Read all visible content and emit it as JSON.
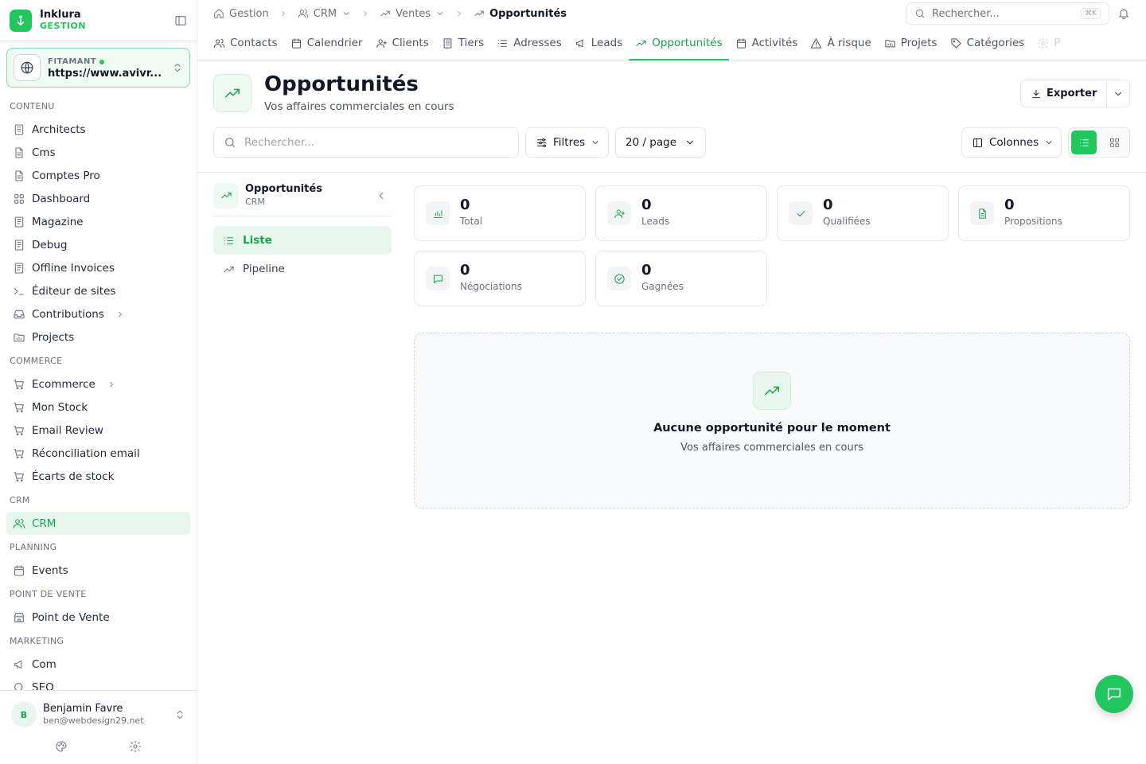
{
  "brand": {
    "name": "Inklura",
    "sub": "GESTION"
  },
  "site": {
    "tag": "FITAMANT",
    "url": "https://www.avivr..."
  },
  "nav": {
    "groups": [
      {
        "label": "CONTENU",
        "items": [
          {
            "label": "Architects",
            "icon": "building-icon"
          },
          {
            "label": "Cms",
            "icon": "file-icon"
          },
          {
            "label": "Comptes Pro",
            "icon": "file-icon"
          },
          {
            "label": "Dashboard",
            "icon": "grid-icon"
          },
          {
            "label": "Magazine",
            "icon": "book-icon"
          },
          {
            "label": "Debug",
            "icon": "book-icon"
          },
          {
            "label": "Offline Invoices",
            "icon": "book-icon"
          },
          {
            "label": "Éditeur de sites",
            "icon": "terminal-icon"
          },
          {
            "label": "Contributions",
            "icon": "inbox-icon",
            "has_children": true
          },
          {
            "label": "Projects",
            "icon": "folder-icon"
          }
        ]
      },
      {
        "label": "COMMERCE",
        "items": [
          {
            "label": "Ecommerce",
            "icon": "cart-icon",
            "has_children": true
          },
          {
            "label": "Mon Stock",
            "icon": "cart-icon"
          },
          {
            "label": "Email Review",
            "icon": "cart-icon"
          },
          {
            "label": "Réconciliation email",
            "icon": "cart-icon"
          },
          {
            "label": "Écarts de stock",
            "icon": "cart-icon"
          }
        ]
      },
      {
        "label": "CRM",
        "items": [
          {
            "label": "CRM",
            "icon": "users-icon",
            "active": true
          }
        ]
      },
      {
        "label": "PLANNING",
        "items": [
          {
            "label": "Events",
            "icon": "calendar-icon"
          }
        ]
      },
      {
        "label": "POINT DE VENTE",
        "items": [
          {
            "label": "Point de Vente",
            "icon": "store-icon"
          }
        ]
      },
      {
        "label": "MARKETING",
        "items": [
          {
            "label": "Com",
            "icon": "megaphone-icon"
          },
          {
            "label": "SEO",
            "icon": "search-icon"
          }
        ]
      }
    ]
  },
  "user": {
    "initial": "B",
    "name": "Benjamin Favre",
    "email": "ben@webdesign29.net"
  },
  "breadcrumb": {
    "home": "Gestion",
    "crm": "CRM",
    "ventes": "Ventes",
    "current": "Opportunités"
  },
  "topsearch": {
    "placeholder": "Rechercher...",
    "shortcut": "⌘K"
  },
  "tabs": [
    {
      "label": "Contacts",
      "icon": "users-icon"
    },
    {
      "label": "Calendrier",
      "icon": "calendar-icon"
    },
    {
      "label": "Clients",
      "icon": "user-plus-icon"
    },
    {
      "label": "Tiers",
      "icon": "building-icon"
    },
    {
      "label": "Adresses",
      "icon": "list-icon"
    },
    {
      "label": "Leads",
      "icon": "megaphone-icon"
    },
    {
      "label": "Opportunités",
      "icon": "trending-up-icon",
      "active": true
    },
    {
      "label": "Activités",
      "icon": "calendar-icon"
    },
    {
      "label": "À risque",
      "icon": "alert-icon"
    },
    {
      "label": "Projets",
      "icon": "folder-icon"
    },
    {
      "label": "Catégories",
      "icon": "tag-icon"
    },
    {
      "label": "P",
      "icon": "gear-icon"
    }
  ],
  "page": {
    "title": "Opportunités",
    "subtitle": "Vos affaires commerciales en cours",
    "export_label": "Exporter"
  },
  "toolbar": {
    "search_placeholder": "Rechercher...",
    "filters_label": "Filtres",
    "page_size": "20 / page",
    "columns_label": "Colonnes"
  },
  "subnav": {
    "title": "Opportunités",
    "subtitle": "CRM",
    "items": [
      {
        "label": "Liste",
        "active": true
      },
      {
        "label": "Pipeline"
      }
    ]
  },
  "stats": [
    {
      "value": "0",
      "label": "Total",
      "icon": "bar-chart-icon"
    },
    {
      "value": "0",
      "label": "Leads",
      "icon": "user-plus-icon"
    },
    {
      "value": "0",
      "label": "Qualifiées",
      "icon": "check-icon"
    },
    {
      "value": "0",
      "label": "Propositions",
      "icon": "file-text-icon"
    },
    {
      "value": "0",
      "label": "Négociations",
      "icon": "message-icon"
    },
    {
      "value": "0",
      "label": "Gagnées",
      "icon": "check-circle-icon"
    }
  ],
  "empty": {
    "title": "Aucune opportunité pour le moment",
    "subtitle": "Vos affaires commerciales en cours"
  },
  "colors": {
    "accent": "#22c55e",
    "accent_dark": "#16a34a",
    "accent_light": "#e8f7ed"
  }
}
